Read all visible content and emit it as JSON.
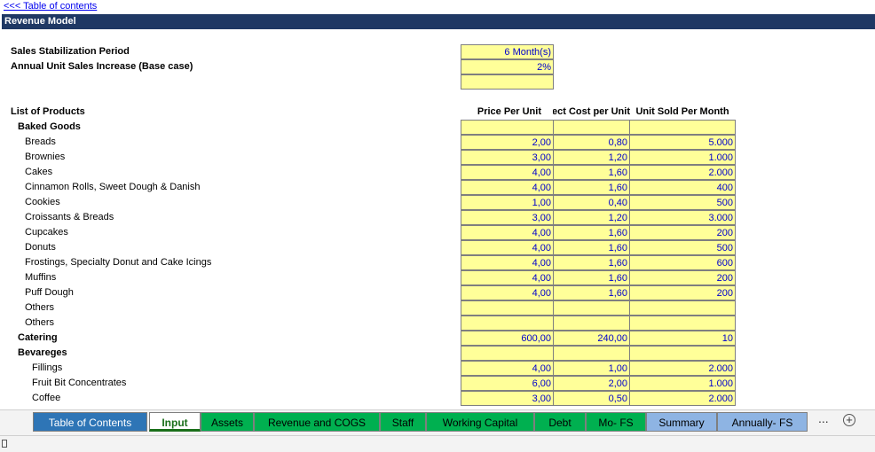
{
  "toc_link": "<<< Table of contents",
  "title": "Revenue Model",
  "settings": {
    "stabilization_label": "Sales Stabilization Period",
    "stabilization_value": "6 Month(s)",
    "increase_label": "Annual Unit Sales Increase (Base case)",
    "increase_value": "2%"
  },
  "list_label": "List of Products",
  "headers": {
    "price": "Price Per Unit",
    "cost": "Direct Cost per Unit",
    "units": "Unit Sold Per Month"
  },
  "groups": {
    "baked": "Baked Goods",
    "catering": "Catering",
    "beverages": "Bevareges"
  },
  "baked_items": [
    {
      "name": "Breads",
      "price": "2,00",
      "cost": "0,80",
      "units": "5.000"
    },
    {
      "name": "Brownies",
      "price": "3,00",
      "cost": "1,20",
      "units": "1.000"
    },
    {
      "name": "Cakes",
      "price": "4,00",
      "cost": "1,60",
      "units": "2.000"
    },
    {
      "name": "Cinnamon Rolls, Sweet Dough & Danish",
      "price": "4,00",
      "cost": "1,60",
      "units": "400"
    },
    {
      "name": "Cookies",
      "price": "1,00",
      "cost": "0,40",
      "units": "500"
    },
    {
      "name": "Croissants & Breads",
      "price": "3,00",
      "cost": "1,20",
      "units": "3.000"
    },
    {
      "name": "Cupcakes",
      "price": "4,00",
      "cost": "1,60",
      "units": "200"
    },
    {
      "name": "Donuts",
      "price": "4,00",
      "cost": "1,60",
      "units": "500"
    },
    {
      "name": "Frostings, Specialty Donut and Cake Icings",
      "price": "4,00",
      "cost": "1,60",
      "units": "600"
    },
    {
      "name": "Muffins",
      "price": "4,00",
      "cost": "1,60",
      "units": "200"
    },
    {
      "name": "Puff Dough",
      "price": "4,00",
      "cost": "1,60",
      "units": "200"
    },
    {
      "name": "Others",
      "price": "",
      "cost": "",
      "units": ""
    },
    {
      "name": "Others",
      "price": "",
      "cost": "",
      "units": ""
    }
  ],
  "catering_row": {
    "price": "600,00",
    "cost": "240,00",
    "units": "10"
  },
  "beverage_items": [
    {
      "name": "Fillings",
      "price": "4,00",
      "cost": "1,00",
      "units": "2.000"
    },
    {
      "name": "Fruit Bit Concentrates",
      "price": "6,00",
      "cost": "2,00",
      "units": "1.000"
    },
    {
      "name": "Coffee",
      "price": "3,00",
      "cost": "0,50",
      "units": "2.000"
    }
  ],
  "tabs": [
    {
      "label": "Table of Contents",
      "bg": "#2e75b6",
      "fg": "#ffffff"
    },
    {
      "label": "Input",
      "bg": "#ffffff",
      "fg": "#1a6f1a"
    },
    {
      "label": "Assets",
      "bg": "#00b050",
      "fg": "#000000"
    },
    {
      "label": "Revenue and COGS",
      "bg": "#00b050",
      "fg": "#000000"
    },
    {
      "label": "Staff",
      "bg": "#00b050",
      "fg": "#000000"
    },
    {
      "label": "Working Capital",
      "bg": "#00b050",
      "fg": "#000000"
    },
    {
      "label": "Debt",
      "bg": "#00b050",
      "fg": "#000000"
    },
    {
      "label": "Mo- FS",
      "bg": "#00b050",
      "fg": "#000000"
    },
    {
      "label": "Summary",
      "bg": "#8eb4e3",
      "fg": "#000000"
    },
    {
      "label": "Annually- FS",
      "bg": "#8eb4e3",
      "fg": "#000000"
    }
  ],
  "more_tabs": "...",
  "add_sheet": "+"
}
